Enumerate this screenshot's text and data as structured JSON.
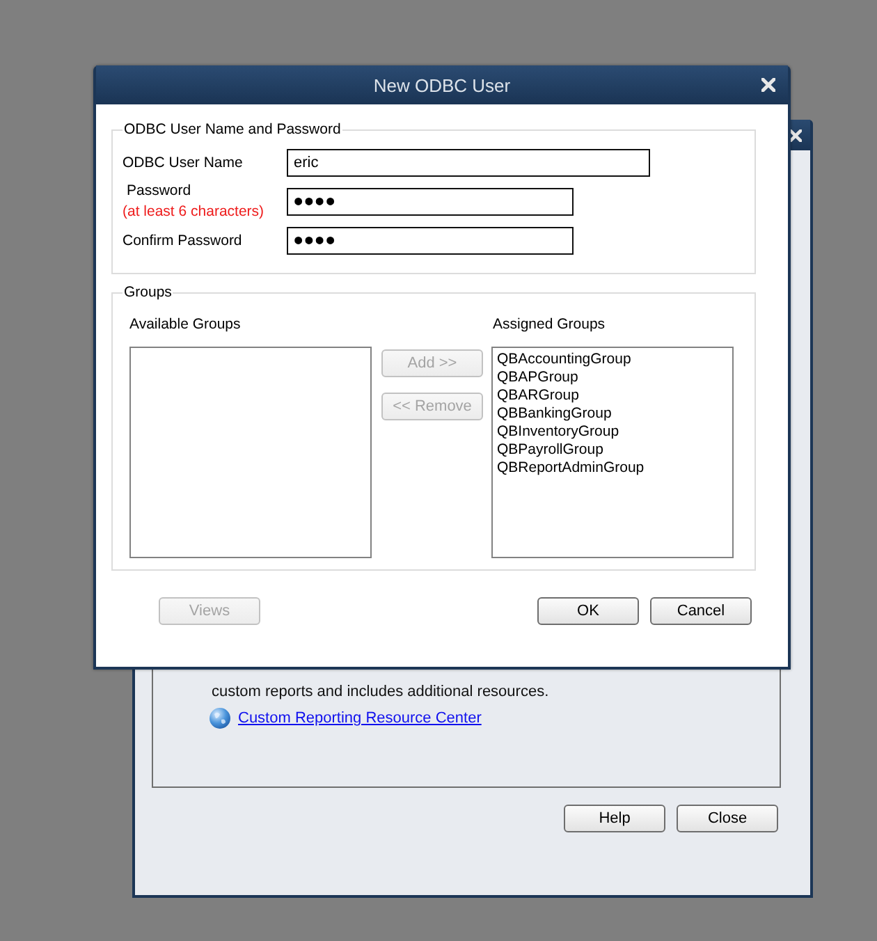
{
  "dialog": {
    "title": "New ODBC User",
    "credentials": {
      "legend": "ODBC User Name and Password",
      "fields": [
        {
          "kind": "text",
          "label": "ODBC User Name",
          "value": "eric"
        },
        {
          "kind": "password",
          "label": "Password",
          "note": "(at least 6 characters)",
          "value": "••••"
        },
        {
          "kind": "password",
          "label": "Confirm Password",
          "value": "••••"
        }
      ]
    },
    "groups": {
      "legend": "Groups",
      "available": {
        "label": "Available Groups"
      },
      "assigned": {
        "label": "Assigned Groups",
        "items": [
          "QBAccountingGroup",
          "QBAPGroup",
          "QBARGroup",
          "QBBankingGroup",
          "QBInventoryGroup",
          "QBPayrollGroup",
          "QBReportAdminGroup"
        ]
      },
      "buttons": [
        {
          "label": "Add >>",
          "disabled": true
        },
        {
          "label": "<< Remove",
          "disabled": true
        }
      ]
    },
    "buttons": [
      {
        "label": "Views",
        "disabled": true
      },
      {
        "label": "OK",
        "disabled": false
      },
      {
        "label": "Cancel",
        "disabled": false
      }
    ]
  },
  "background_window": {
    "description": "custom reports and includes additional resources.",
    "link": "Custom Reporting Resource Center",
    "buttons": [
      {
        "label": "Help",
        "disabled": false
      },
      {
        "label": "Close",
        "disabled": false
      }
    ]
  }
}
